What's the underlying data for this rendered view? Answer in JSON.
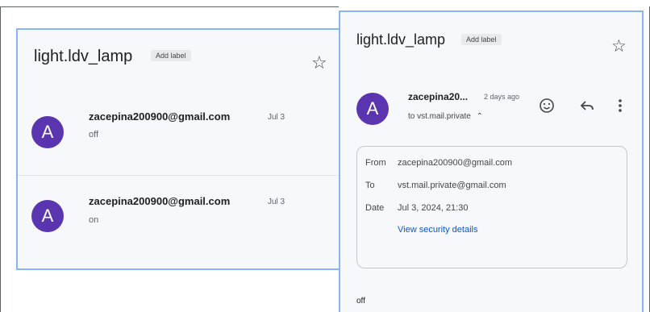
{
  "left_panel": {
    "subject": "light.ldv_lamp",
    "label_chip": "Add label",
    "star_icon": "star-outline-icon",
    "threads": [
      {
        "avatar_letter": "A",
        "sender": "zacepina200900@gmail.com",
        "date": "Jul 3",
        "snippet": "off"
      },
      {
        "avatar_letter": "A",
        "sender": "zacepina200900@gmail.com",
        "date": "Jul 3",
        "snippet": "on"
      }
    ]
  },
  "right_panel": {
    "subject": "light.ldv_lamp",
    "label_chip": "Add label",
    "star_icon": "star-outline-icon",
    "message": {
      "avatar_letter": "A",
      "sender": "zacepina20...",
      "time": "2 days ago",
      "to_line": "to vst.mail.private",
      "icons": [
        "emoji-icon",
        "reply-icon",
        "more-vert-icon"
      ]
    },
    "details": {
      "from_label": "From",
      "from_value": "zacepina200900@gmail.com",
      "to_label": "To",
      "to_value": "vst.mail.private@gmail.com",
      "date_label": "Date",
      "date_value": "Jul 3, 2024, 21:30",
      "security_link": "View security details"
    },
    "body": "off"
  },
  "colors": {
    "avatar": "#5b35b0",
    "panel_border": "#8ab4f8",
    "panel_bg": "#f6f8fc",
    "link": "#0b57d0"
  }
}
